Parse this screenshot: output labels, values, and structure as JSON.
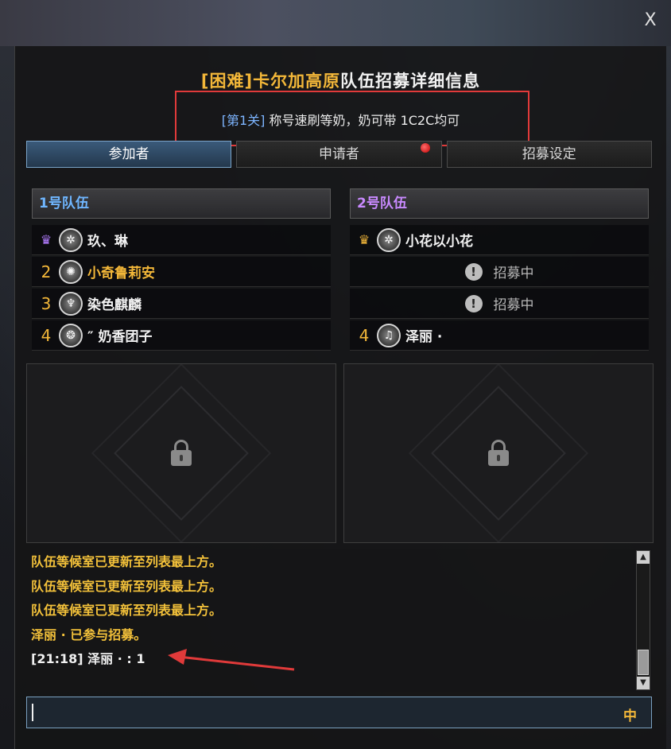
{
  "window": {
    "title_prefix": "[困难]卡尔加高原",
    "title_suffix": "队伍招募详细信息",
    "stage_tag": "[第1关]",
    "description": "称号速刷等奶，奶可带 1C2C均可",
    "close_label": "X"
  },
  "tabs": [
    {
      "label": "参加者",
      "active": true
    },
    {
      "label": "申请者",
      "active": false,
      "has_notification": true
    },
    {
      "label": "招募设定",
      "active": false
    }
  ],
  "party1": {
    "header": "1号队伍",
    "members": [
      {
        "slot": "",
        "leader": true,
        "name": "玖、琳"
      },
      {
        "slot": "2",
        "name": "小奇鲁莉安"
      },
      {
        "slot": "3",
        "name": "染色麒麟"
      },
      {
        "slot": "4",
        "name": "″ 奶香团子"
      }
    ]
  },
  "party2": {
    "header": "2号队伍",
    "members": [
      {
        "slot": "",
        "leader": true,
        "name": "小花以小花"
      },
      {
        "status": "招募中"
      },
      {
        "status": "招募中"
      },
      {
        "slot": "4",
        "name": "泽丽 ·"
      }
    ]
  },
  "chat": {
    "lines": [
      "队伍等候室已更新至列表最上方。",
      "队伍等候室已更新至列表最上方。",
      "队伍等候室已更新至列表最上方。",
      "泽丽 · 已参与招募。",
      "[21:18] 泽丽 · : 1"
    ]
  },
  "input": {
    "ime_indicator": "中"
  }
}
